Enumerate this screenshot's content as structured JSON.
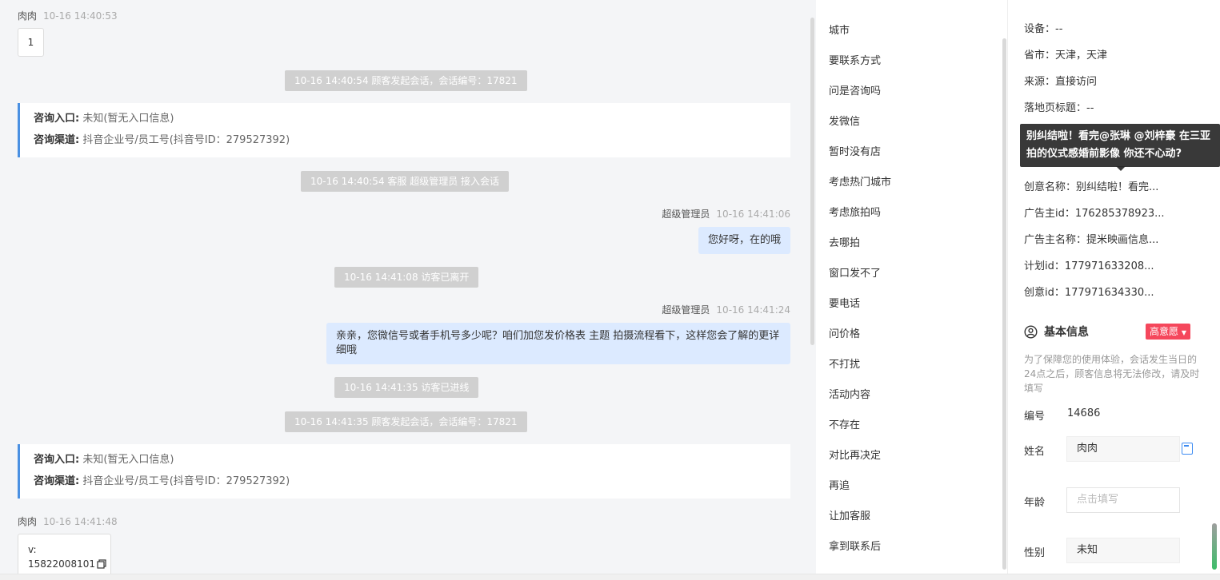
{
  "chat": {
    "messages": [
      {
        "sender": "肉肉",
        "time": "10-16 14:40:53",
        "text": "1"
      },
      {
        "system": "10-16 14:40:54 顾客发起会话，会话编号：17821"
      },
      {
        "entry_label": "咨询入口:",
        "entry_value": "未知(暂无入口信息)",
        "channel_label": "咨询渠道:",
        "channel_value": "抖音企业号/员工号(抖音号ID：279527392)"
      },
      {
        "system": "10-16 14:40:54 客服 超级管理员 接入会话"
      },
      {
        "sender": "超级管理员",
        "time": "10-16 14:41:06",
        "text": "您好呀，在的哦"
      },
      {
        "system": "10-16 14:41:08 访客已离开"
      },
      {
        "sender": "超级管理员",
        "time": "10-16 14:41:24",
        "text": "亲亲，您微信号或者手机号多少呢？咱们加您发价格表 主题 拍摄流程看下，这样您会了解的更详细哦"
      },
      {
        "system": "10-16 14:41:35 访客已进线"
      },
      {
        "system": "10-16 14:41:35 顾客发起会话，会话编号：17821"
      },
      {
        "entry_label": "咨询入口:",
        "entry_value": "未知(暂无入口信息)",
        "channel_label": "咨询渠道:",
        "channel_value": "抖音企业号/员工号(抖音号ID：279527392)"
      },
      {
        "sender": "肉肉",
        "time": "10-16 14:41:48",
        "text_line1": "v:",
        "text_line2": "15822008101"
      }
    ]
  },
  "quick_replies": {
    "items": [
      "城市",
      "要联系方式",
      "问是咨询吗",
      "发微信",
      "暂时没有店",
      "考虑热门城市",
      "考虑旅拍吗",
      "去哪拍",
      "窗口发不了",
      "要电话",
      "问价格",
      "不打扰",
      "活动内容",
      "不存在",
      "对比再决定",
      "再追",
      "让加客服",
      "拿到联系后"
    ]
  },
  "panel": {
    "fields": {
      "device": "设备：--",
      "province_city": "省市：天津，天津",
      "source": "来源：直接访问",
      "landing_title": "落地页标题：--",
      "creative_name": "创意名称：别纠结啦！看完...",
      "advertiser_id": "广告主id：176285378923...",
      "advertiser_name": "广告主名称：提米映画信息...",
      "plan_id": "计划id：177971633208...",
      "creative_id": "创意id：177971634330..."
    },
    "tooltip": "别纠结啦！看完@张琳 @刘梓豪 在三亚拍的仪式感婚前影像 你还不心动?",
    "basic_info_title": "基本信息",
    "intent_badge": "高意愿",
    "notice": "为了保障您的使用体验，会话发生当日的24点之后，顾客信息将无法修改，请及时填写",
    "id_label": "编号",
    "id_value": "14686",
    "name_label": "姓名",
    "name_value": "肉肉",
    "age_label": "年龄",
    "age_placeholder": "点击填写",
    "gender_label": "性别",
    "gender_value": "未知"
  },
  "colors": {
    "accent": "#4a90e2",
    "badge": "#f5475c",
    "agent_bubble": "#dceaff"
  }
}
